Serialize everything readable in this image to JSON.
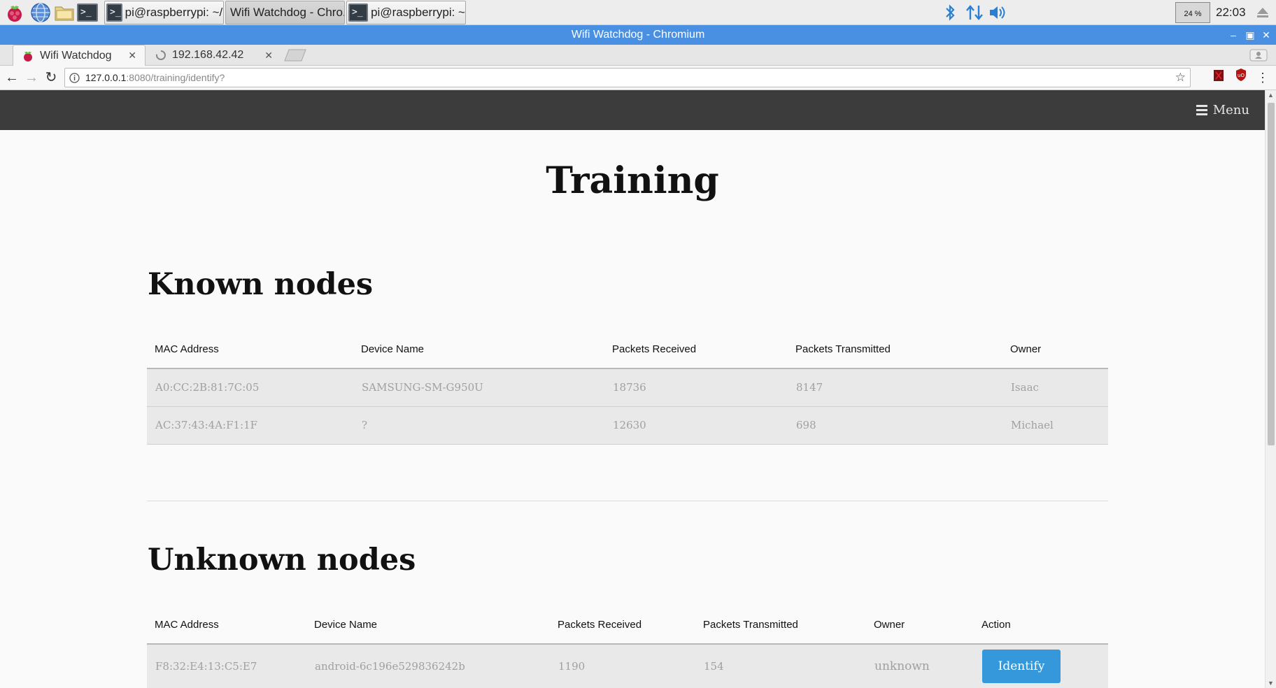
{
  "taskbar": {
    "tasks": [
      {
        "label": "pi@raspberrypi: ~/De..."
      },
      {
        "label": "Wifi Watchdog - Chro..."
      },
      {
        "label": "pi@raspberrypi: ~"
      }
    ],
    "cpu": "24 %",
    "clock": "22:03"
  },
  "window": {
    "title": "Wifi Watchdog - Chromium"
  },
  "browser": {
    "tabs": [
      {
        "label": "Wifi Watchdog"
      },
      {
        "label": "192.168.42.42"
      }
    ],
    "url_host": "127.0.0.1",
    "url_path": ":8080/training/identify?"
  },
  "site": {
    "menu_label": "Menu",
    "page_title": "Training"
  },
  "known": {
    "title": "Known nodes",
    "headers": [
      "MAC Address",
      "Device Name",
      "Packets Received",
      "Packets Transmitted",
      "Owner"
    ],
    "rows": [
      [
        "A0:CC:2B:81:7C:05",
        "SAMSUNG-SM-G950U",
        "18736",
        "8147",
        "Isaac"
      ],
      [
        "AC:37:43:4A:F1:1F",
        "?",
        "12630",
        "698",
        "Michael"
      ]
    ]
  },
  "unknown": {
    "title": "Unknown nodes",
    "headers": [
      "MAC Address",
      "Device Name",
      "Packets Received",
      "Packets Transmitted",
      "Owner",
      "Action"
    ],
    "rows": [
      [
        "F8:32:E4:13:C5:E7",
        "android-6c196e529836242b",
        "1190",
        "154",
        "unknown"
      ]
    ],
    "action_label": "Identify"
  },
  "colors": {
    "header_bg": "#3c3c3c",
    "button": "#3498db",
    "titlebar": "#4a90e2"
  }
}
